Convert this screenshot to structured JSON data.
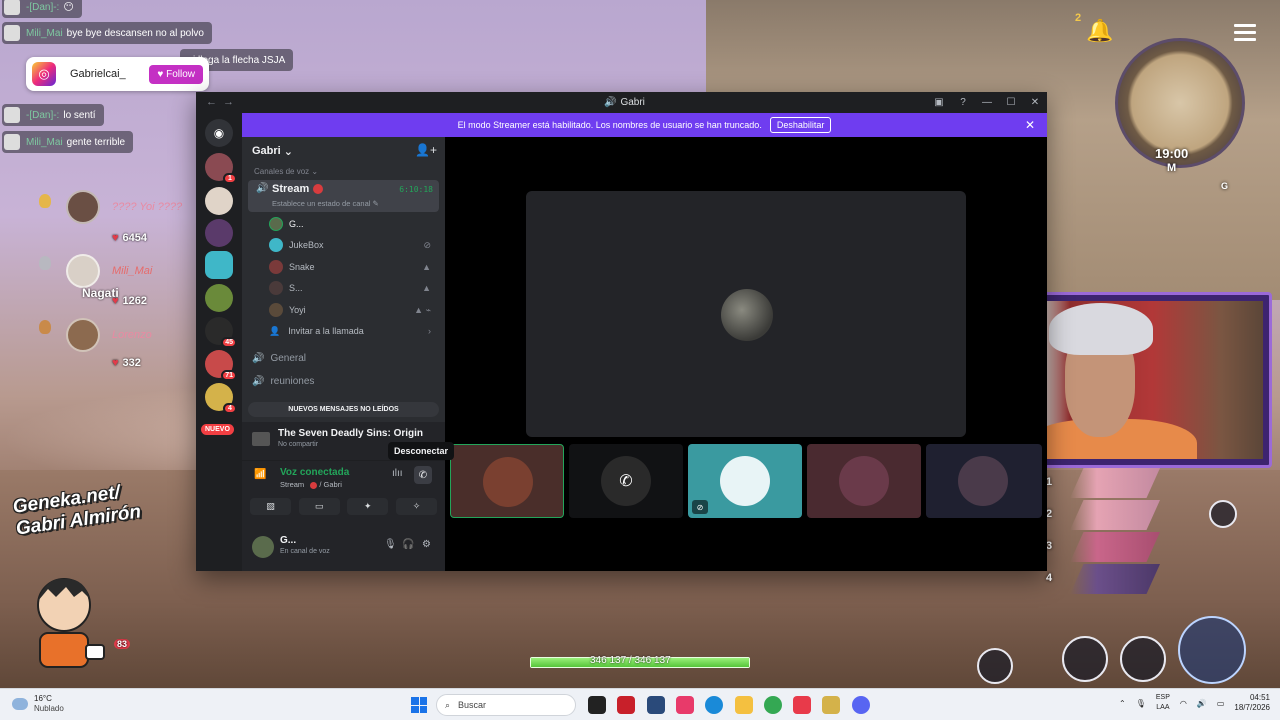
{
  "chat": {
    "messages": [
      {
        "user": "-[Dan]-:",
        "text": "😶"
      },
      {
        "user": "Mili_Mai",
        "text": "bye bye descansen no al polvo"
      },
      {
        "user": "",
        "text": "si llega la flecha JSJA"
      },
      {
        "user": "-[Dan]-:",
        "text": "lo sentí"
      },
      {
        "user": "Mili_Mai",
        "text": "gente terrible"
      }
    ],
    "instagram": {
      "name": "Gabrielcai_",
      "follow_label": "Follow"
    }
  },
  "leaderboard": [
    {
      "name": "???? Yoi ????",
      "score": "6454"
    },
    {
      "name": "Mili_Mai",
      "score": "1262"
    },
    {
      "name": "Lorenzo",
      "score": "332"
    }
  ],
  "overlay_tags": {
    "nagati": "Nagati",
    "brand": "Geneka.net/\nGabri Almirón",
    "mascot_count": "83"
  },
  "hud": {
    "time": "19:00",
    "map_label": "M",
    "key_g": "G",
    "bell_count": "2",
    "hp": "346 137 / 346 137",
    "hp_fraction": 1.0,
    "party_slots": [
      "1",
      "2",
      "3",
      "4"
    ]
  },
  "discord": {
    "window_title": "Gabri",
    "streamer_banner": "El modo Streamer está habilitado. Los nombres de usuario se han truncado.",
    "streamer_disable": "Deshabilitar",
    "server_name": "Gabri",
    "category": "Canales de voz",
    "stream_channel": {
      "name": "Stream",
      "timer": "6:10:18",
      "status": "Establece un estado de canal"
    },
    "members": [
      {
        "name": "G..."
      },
      {
        "name": "JukeBox"
      },
      {
        "name": "Snake"
      },
      {
        "name": "S..."
      },
      {
        "name": "Yoyi"
      }
    ],
    "invite_call": "Invitar a la llamada",
    "voice_channels": [
      "General",
      "reuniones"
    ],
    "new_messages": "NUEVOS MENSAJES NO LEÍDOS",
    "new_badge": "NUEVO",
    "server_badges": [
      "1",
      "45",
      "71",
      "4"
    ],
    "activity": {
      "title": "The Seven Deadly Sins: Origin",
      "sub": "No compartir"
    },
    "voice": {
      "title": "Voz conectada",
      "sub": "Stream",
      "sub_server": "/ Gabri",
      "tooltip": "Desconectar"
    },
    "user": {
      "name": "G...",
      "status": "En canal de voz"
    }
  },
  "taskbar": {
    "temp": "16°C",
    "condition": "Nublado",
    "search_placeholder": "Buscar",
    "lang": "ESP",
    "lang_sub": "LAA",
    "time": "04:51",
    "date": "18/7/2026"
  },
  "colors": {
    "discord_accent": "#6f3df0",
    "discord_green": "#23a55a",
    "discord_red": "#f23f43"
  }
}
